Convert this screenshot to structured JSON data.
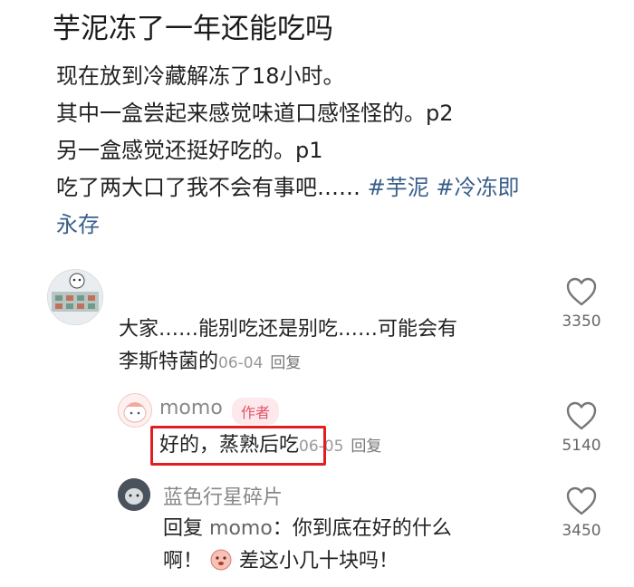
{
  "post": {
    "title": "芋泥冻了一年还能吃吗",
    "lines": [
      "现在放到冷藏解冻了18小时。",
      "其中一盒尝起来感觉味道口感怪怪的。p2",
      "另一盒感觉还挺好吃的。p1"
    ],
    "last_line_text": "吃了两大口了我不会有事吧……",
    "tags": [
      "#芋泥",
      "#冷冻即",
      "永存"
    ]
  },
  "comments": [
    {
      "text_line1": "大家……能别吃还是别吃……可能会有",
      "text_line2": "李斯特菌的",
      "date": "06-04",
      "reply_label": "回复",
      "likes": "3350"
    },
    {
      "username": "momo",
      "badge": "作者",
      "text": "好的，蒸熟后吃",
      "date": "06-05",
      "reply_label": "回复",
      "likes": "5140"
    },
    {
      "username": "蓝色行星碎片",
      "reply_prefix": "回复",
      "reply_to": "momo",
      "text_line1": "：你到底在好的什么",
      "text_line2_a": "啊！",
      "text_line2_b": "差这小几十块吗！",
      "likes": "3450"
    }
  ],
  "colors": {
    "tag": "#3a5f8a",
    "badge": "#e0556a",
    "highlight": "#e02020"
  },
  "icons": [
    "heart-outline-icon",
    "emoji-face-icon"
  ]
}
